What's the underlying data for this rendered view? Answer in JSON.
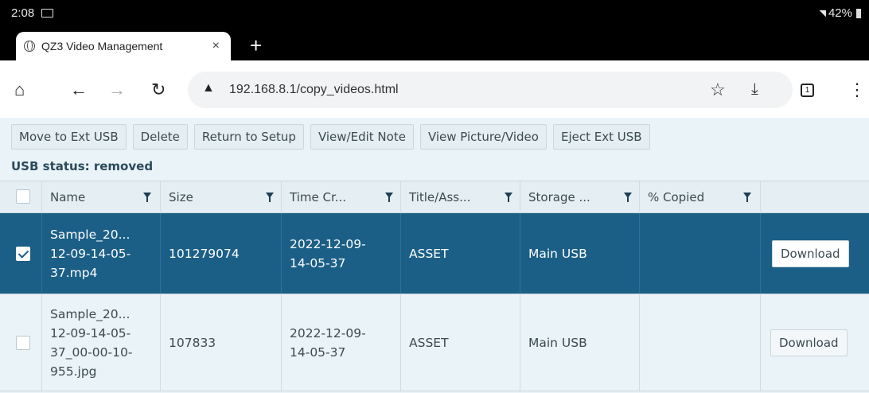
{
  "status_bar": {
    "time": "2:08",
    "battery": "42%"
  },
  "browser": {
    "tab_title": "QZ3 Video Management",
    "tab_close": "×",
    "new_tab": "+",
    "url": "192.168.8.1/copy_videos.html"
  },
  "actions": [
    "Move to Ext USB",
    "Delete",
    "Return to Setup",
    "View/Edit Note",
    "View Picture/Video",
    "Eject Ext USB"
  ],
  "usb_status": "USB status: removed",
  "columns": [
    "Name",
    "Size",
    "Time Cr...",
    "Title/Ass...",
    "Storage ...",
    "% Copied"
  ],
  "rows": [
    {
      "selected": true,
      "name_lines": [
        "Sample_20...",
        "12-09-14-05-",
        "37.mp4"
      ],
      "size": "101279074",
      "time_lines": [
        "2022-12-09-",
        "14-05-37"
      ],
      "title": "ASSET",
      "storage": "Main USB",
      "copied": "",
      "action": "Download"
    },
    {
      "selected": false,
      "name_lines": [
        "Sample_20...",
        "12-09-14-05-",
        "37_00-00-10-",
        "955.jpg"
      ],
      "size": "107833",
      "time_lines": [
        "2022-12-09-",
        "14-05-37"
      ],
      "title": "ASSET",
      "storage": "Main USB",
      "copied": "",
      "action": "Download"
    }
  ]
}
